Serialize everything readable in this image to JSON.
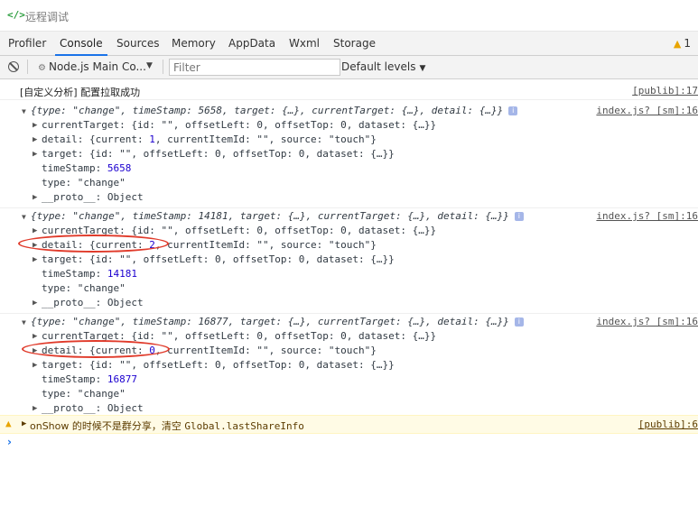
{
  "window": {
    "title": "远程调试",
    "icon": "code-icon"
  },
  "tabs": [
    {
      "label": "Profiler"
    },
    {
      "label": "Console",
      "active": true
    },
    {
      "label": "Sources"
    },
    {
      "label": "Memory"
    },
    {
      "label": "AppData"
    },
    {
      "label": "Wxml"
    },
    {
      "label": "Storage"
    }
  ],
  "warning_count": "1",
  "toolbar": {
    "context": "Node.js Main Co...",
    "filter_placeholder": "Filter",
    "levels": "Default levels"
  },
  "messages": [
    {
      "text": "[自定义分析] 配置拉取成功",
      "src": "[publib]:17"
    }
  ],
  "events": [
    {
      "src": "index.js? [sm]:16",
      "timeStamp": "5658",
      "current": "1",
      "summary": {
        "type": "\"change\"",
        "timeStamp": "5658"
      }
    },
    {
      "src": "index.js? [sm]:16",
      "timeStamp": "14181",
      "current": "2",
      "summary": {
        "type": "\"change\"",
        "timeStamp": "14181"
      }
    },
    {
      "src": "index.js? [sm]:16",
      "timeStamp": "16877",
      "current": "0",
      "summary": {
        "type": "\"change\"",
        "timeStamp": "16877"
      }
    }
  ],
  "labels": {
    "type_key": "type: ",
    "ts_key": ", timeStamp: ",
    "summary_tail": ", target: {…}, currentTarget: {…}, detail: {…}}",
    "currentTarget": "currentTarget: {id: \"\", offsetLeft: 0, offsetTop: 0, dataset: {…}}",
    "detail_pre": "detail: {current: ",
    "detail_post": ", currentItemId: \"\", source: \"touch\"}",
    "target": "target: {id: \"\", offsetLeft: 0, offsetTop: 0, dataset: {…}}",
    "timeStamp_key": "timeStamp: ",
    "type_line": "type: \"change\"",
    "proto": "__proto__: Object"
  },
  "warning": {
    "text_pre": "onShow 的时候不是群分享，清空 ",
    "text_code": "Global.lastShareInfo",
    "src": "[publib]:6"
  },
  "colors": {
    "annotation": "#e03a2a",
    "accent": "#1a73e8",
    "warning": "#e8a400"
  }
}
